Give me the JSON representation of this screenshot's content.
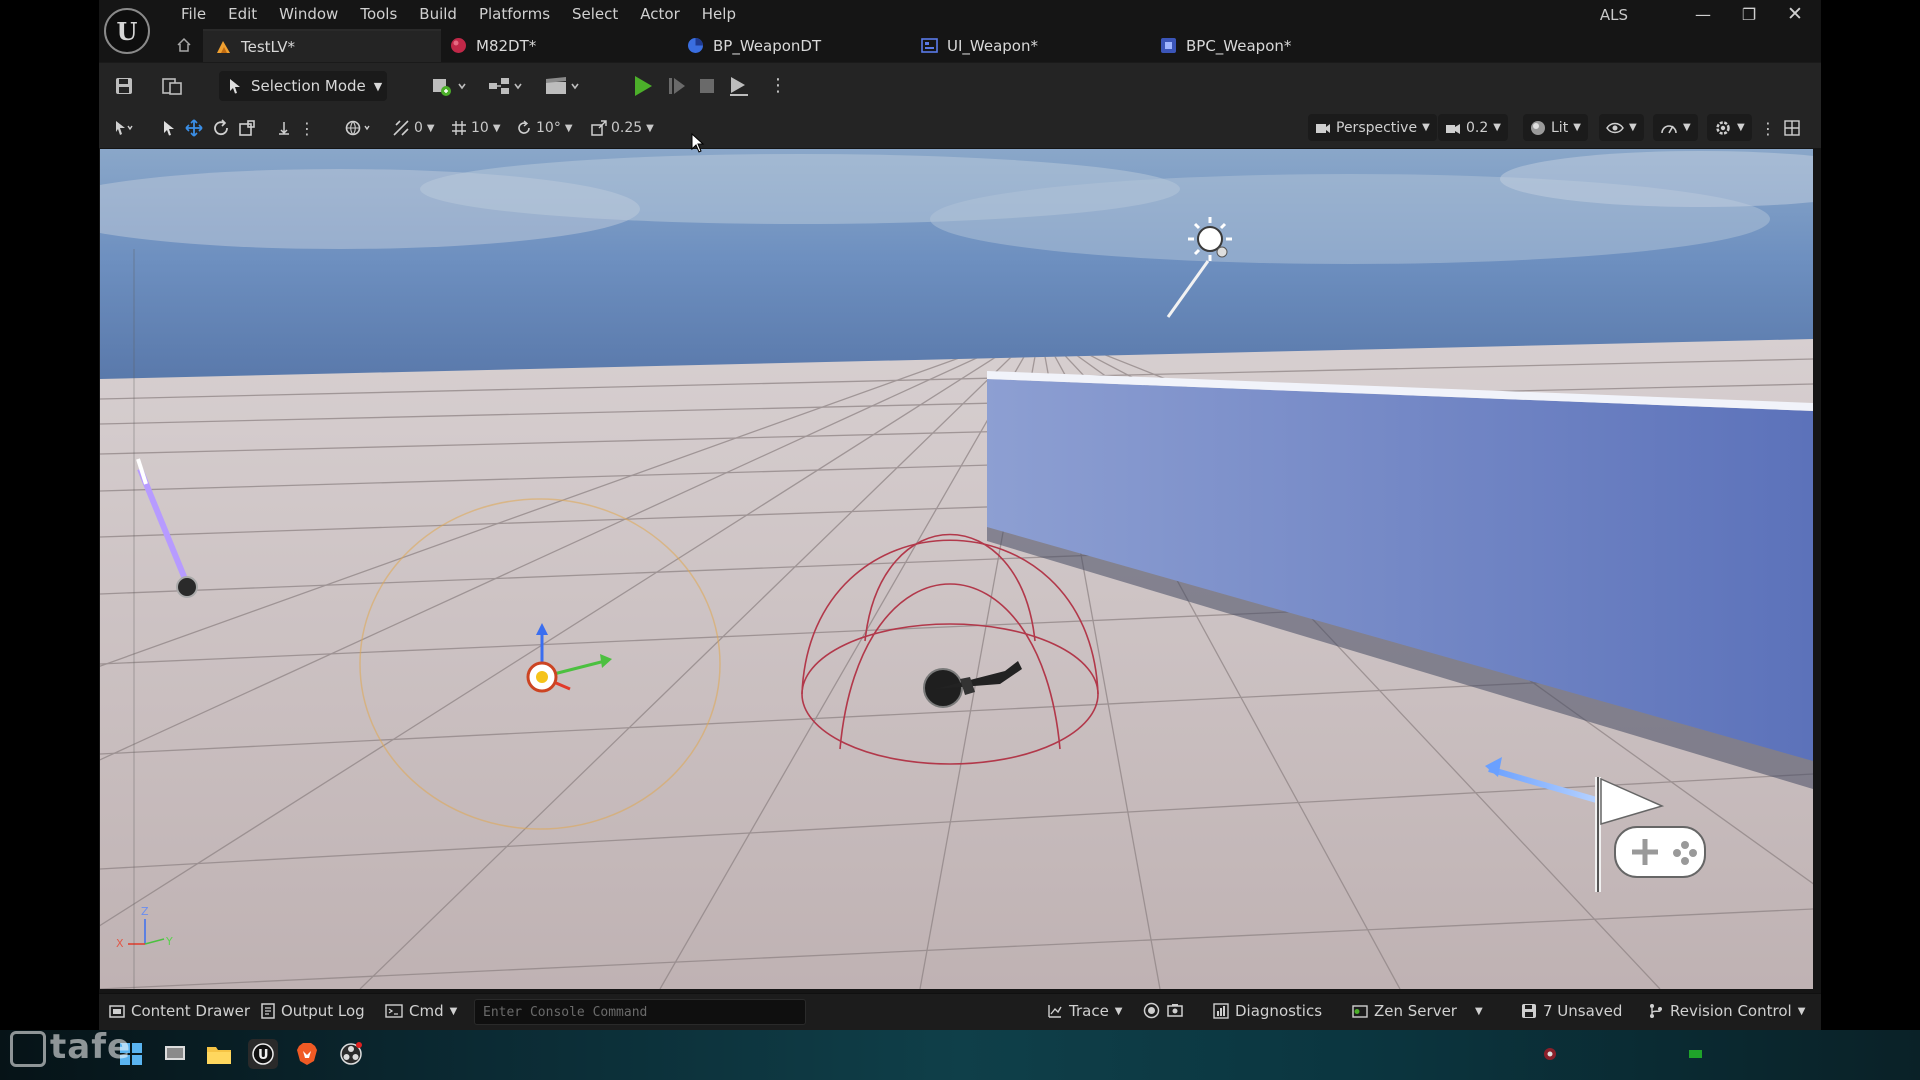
{
  "app": {
    "project_name": "ALS"
  },
  "menu": {
    "items": [
      "File",
      "Edit",
      "Window",
      "Tools",
      "Build",
      "Platforms",
      "Select",
      "Actor",
      "Help"
    ]
  },
  "tabs": [
    {
      "label": "TestLV*",
      "icon": "level-icon",
      "color": "#f0a030"
    },
    {
      "label": "M82DT*",
      "icon": "material-icon",
      "color": "#c02848"
    },
    {
      "label": "BP_WeaponDT",
      "icon": "blueprint-icon",
      "color": "#3a6ee0"
    },
    {
      "label": "UI_Weapon*",
      "icon": "widget-blueprint-icon",
      "color": "#5a7ae8"
    },
    {
      "label": "BPC_Weapon*",
      "icon": "blueprint-component-icon",
      "color": "#5a7ae8"
    }
  ],
  "toolbar": {
    "selection_mode_label": "Selection Mode",
    "play_color": "#4caf2a"
  },
  "viewport_toolbar": {
    "translate_snap": "0",
    "grid_snap": "10",
    "rotation_snap": "10°",
    "scale_snap": "0.25",
    "view_mode": "Perspective",
    "camera_speed": "0.2",
    "lighting_mode": "Lit"
  },
  "scene": {
    "axis_labels": {
      "x": "X",
      "y": "Y",
      "z": "Z"
    }
  },
  "statusbar": {
    "content_drawer": "Content Drawer",
    "output_log": "Output Log",
    "cmd": "Cmd",
    "console_placeholder": "Enter Console Command",
    "trace": "Trace",
    "diagnostics": "Diagnostics",
    "zen_server": "Zen Server",
    "unsaved": "7 Unsaved",
    "revision_control": "Revision Control"
  },
  "taskbar": {
    "watermark": "tafe"
  }
}
